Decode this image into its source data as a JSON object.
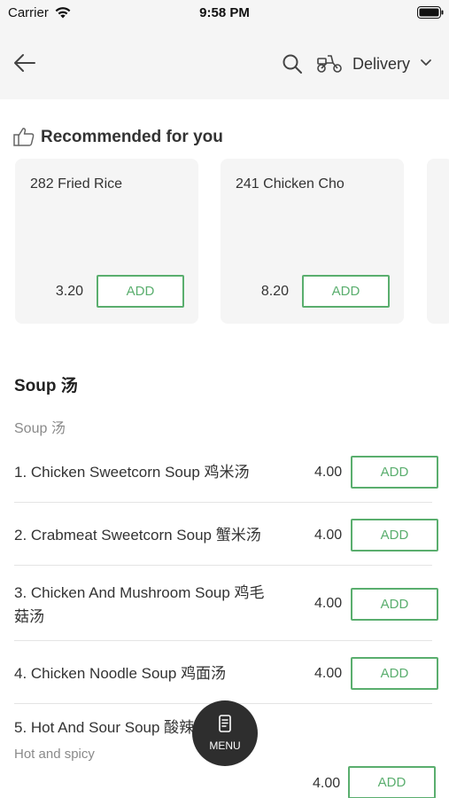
{
  "status_bar": {
    "carrier": "Carrier",
    "time": "9:58 PM"
  },
  "header": {
    "delivery_mode": "Delivery"
  },
  "recommended": {
    "title": "Recommended for you",
    "items": [
      {
        "name": "282 Fried Rice",
        "price": "3.20",
        "add_label": "ADD"
      },
      {
        "name": "241 Chicken Cho",
        "price": "8.20",
        "add_label": "ADD"
      }
    ]
  },
  "section": {
    "title": "Soup 汤",
    "subtitle": "Soup 汤",
    "items": [
      {
        "name": "1. Chicken Sweetcorn Soup 鸡米汤",
        "price": "4.00",
        "add_label": "ADD",
        "description": ""
      },
      {
        "name": "2. Crabmeat Sweetcorn Soup 蟹米汤",
        "price": "4.00",
        "add_label": "ADD",
        "description": ""
      },
      {
        "name": "3. Chicken And Mushroom Soup 鸡毛菇汤",
        "price": "4.00",
        "add_label": "ADD",
        "description": ""
      },
      {
        "name": "4. Chicken Noodle Soup 鸡面汤",
        "price": "4.00",
        "add_label": "ADD",
        "description": ""
      },
      {
        "name": "5. Hot And Sour Soup 酸辣汤",
        "price": "4.00",
        "add_label": "ADD",
        "description": "Hot and spicy"
      }
    ]
  },
  "menu_button": {
    "label": "MENU"
  },
  "icons": {
    "back": "arrow-left-icon",
    "search": "search-icon",
    "delivery": "scooter-icon",
    "dropdown": "chevron-down-icon",
    "recommended": "thumbs-up-icon",
    "menu": "menu-book-icon"
  },
  "colors": {
    "accent": "#5aae6e",
    "header_bg": "#f5f5f5",
    "card_bg": "#f5f5f5",
    "fab_bg": "#2e2e2e"
  }
}
